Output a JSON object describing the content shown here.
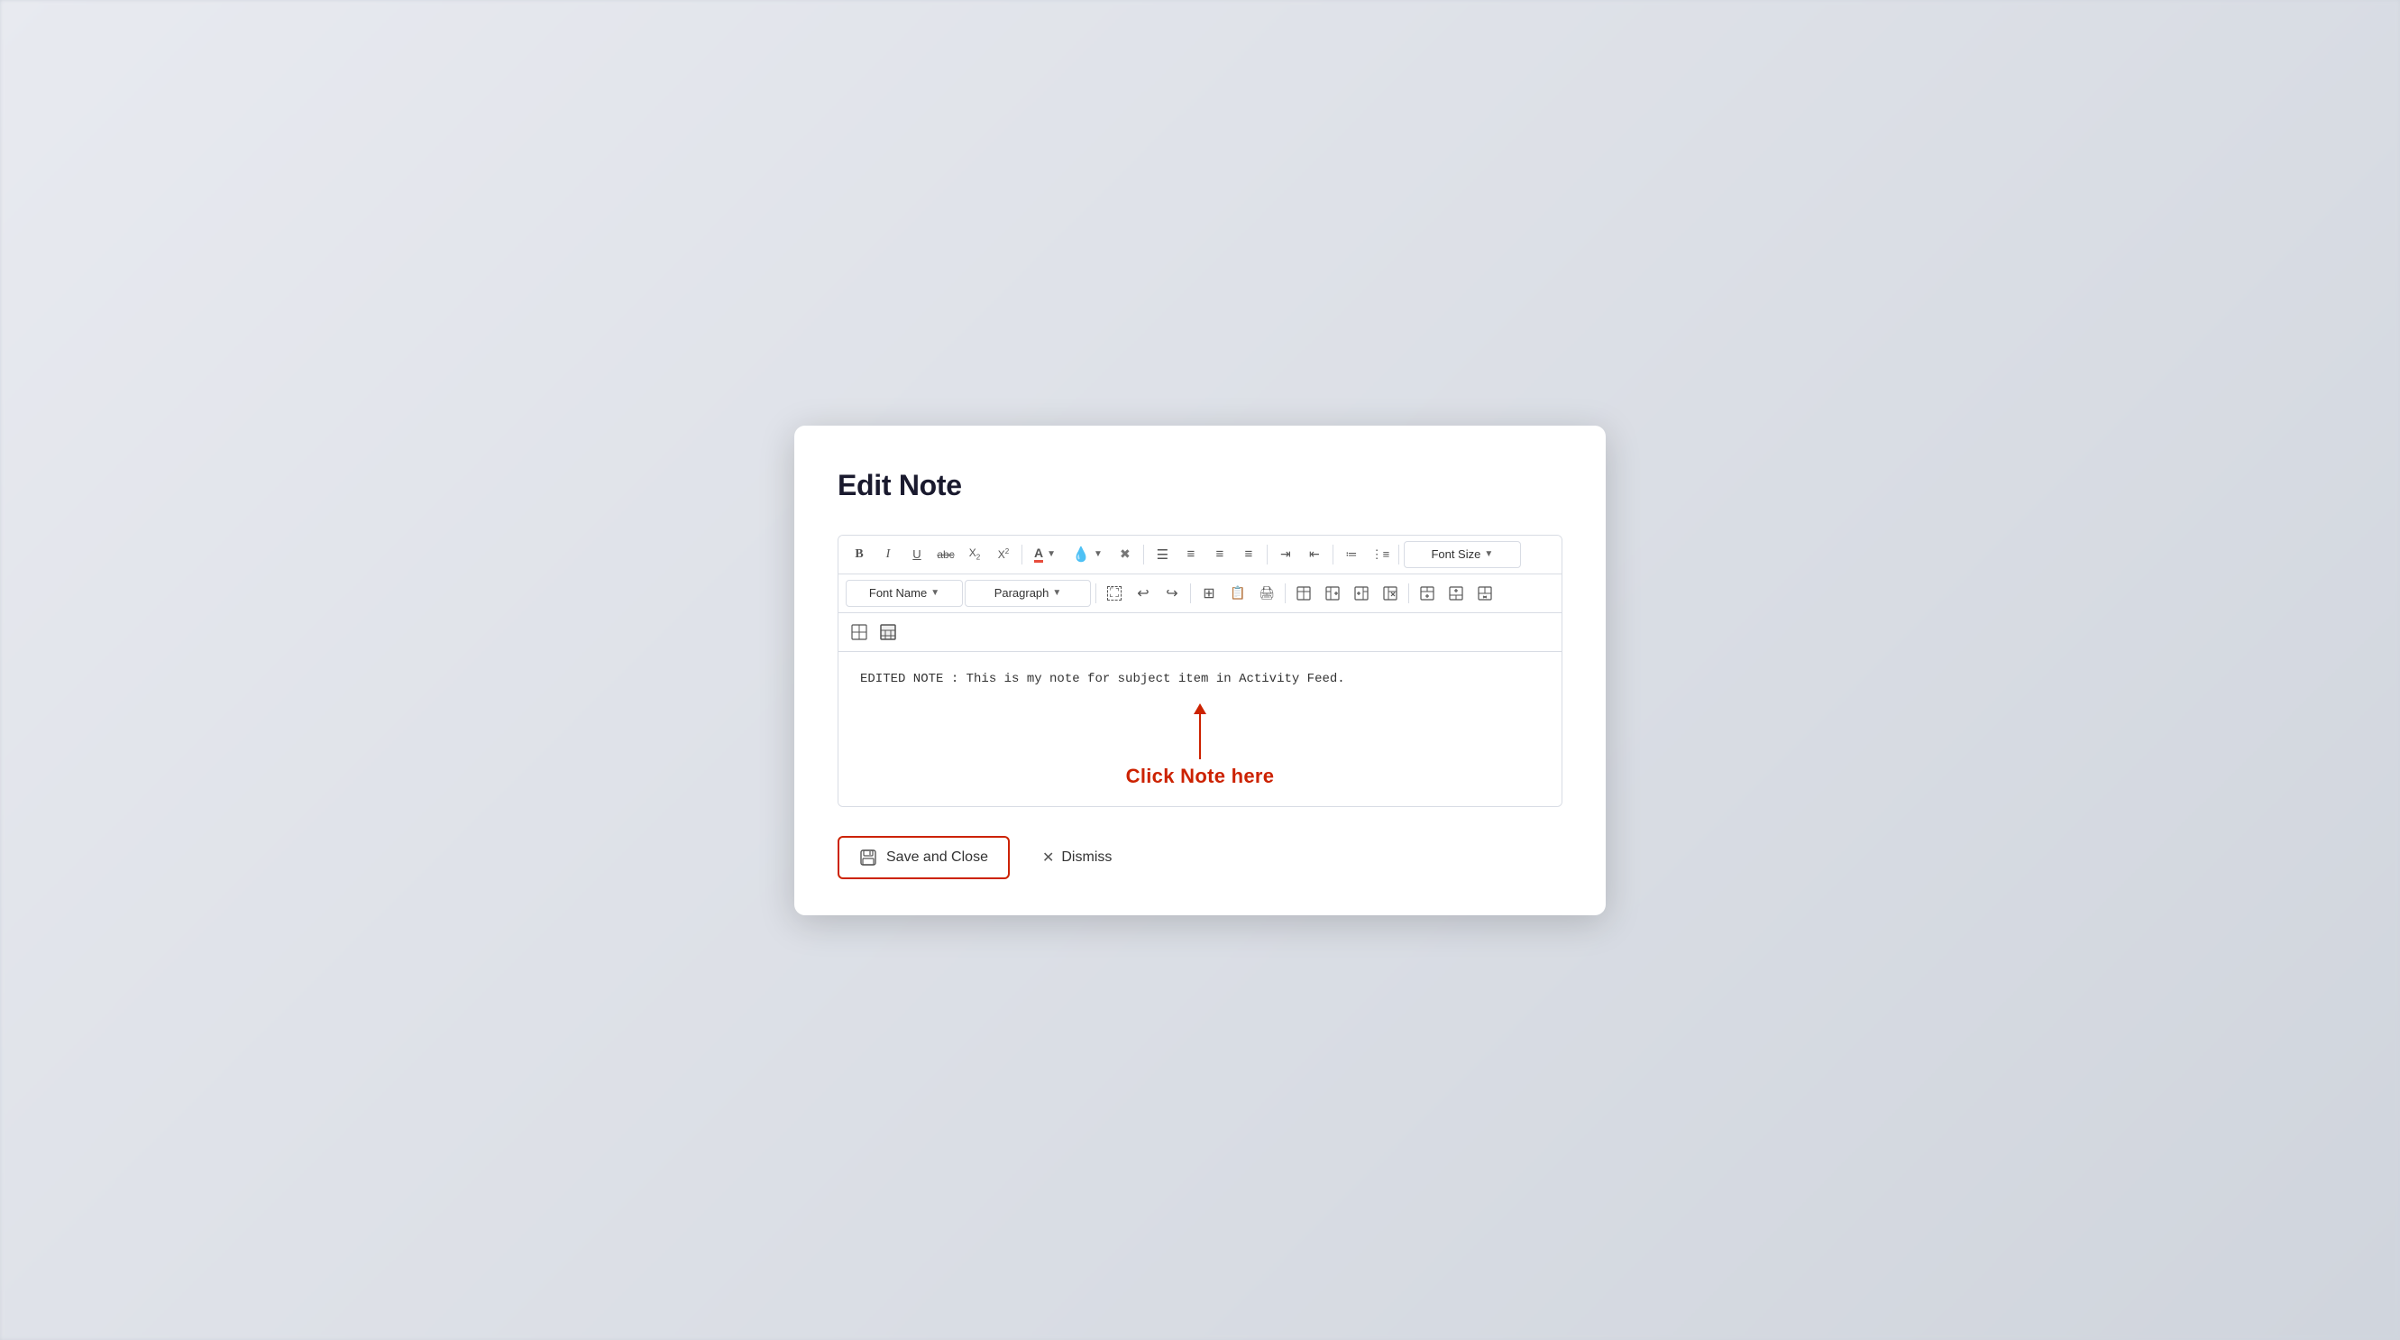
{
  "modal": {
    "title": "Edit Note",
    "editor_content": "EDITED NOTE : This is my note for subject item in Activity Feed.",
    "annotation_text": "Click Note here"
  },
  "toolbar": {
    "row1": {
      "bold": "B",
      "italic": "I",
      "underline": "U",
      "strikethrough": "abc",
      "subscript": "X₂",
      "superscript": "X²",
      "font_color_btn": "A",
      "highlight_btn": "◉",
      "clear_format": "✖",
      "align_left": "≡",
      "align_center": "≡",
      "align_right": "≡",
      "align_justify": "≡",
      "indent_more": "⇥",
      "indent_less": "⇤",
      "numbered_list": "1.",
      "bullet_list": "•",
      "font_size_placeholder": "Font Size"
    },
    "row2": {
      "font_name_placeholder": "Font Name",
      "paragraph_placeholder": "Paragraph",
      "select_all": "⛶",
      "undo": "↩",
      "redo": "↪",
      "table_icon": "⊞",
      "pdf_icon": "📄",
      "print_icon": "🖨",
      "table_btns": [
        "⊞",
        "⊟",
        "⊠",
        "⊡",
        "⊞",
        "⊟",
        "⊠"
      ]
    },
    "row3": {
      "col_icons": [
        "⊡",
        "⊞"
      ]
    }
  },
  "footer": {
    "save_label": "Save and Close",
    "dismiss_label": "Dismiss"
  },
  "colors": {
    "border_btn": "#cc2200",
    "annotation_color": "#cc2200",
    "modal_bg": "#ffffff"
  }
}
